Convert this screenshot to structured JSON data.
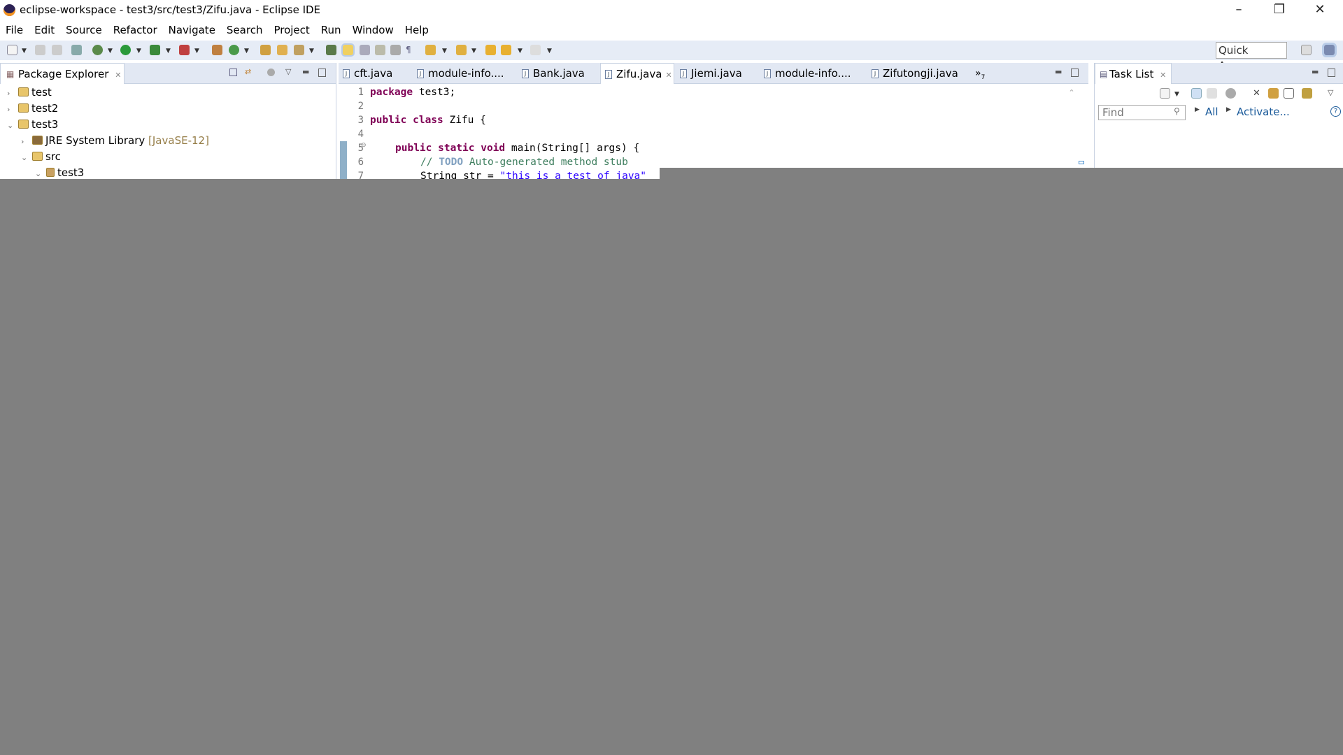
{
  "window": {
    "title": "eclipse-workspace - test3/src/test3/Zifu.java - Eclipse IDE"
  },
  "menu": [
    "File",
    "Edit",
    "Source",
    "Refactor",
    "Navigate",
    "Search",
    "Project",
    "Run",
    "Window",
    "Help"
  ],
  "toolbar": {
    "quick_access": "Quick Access"
  },
  "package_explorer": {
    "title": "Package Explorer",
    "tree": [
      {
        "label": "test",
        "expanded": false,
        "level": 0
      },
      {
        "label": "test2",
        "expanded": false,
        "level": 0
      },
      {
        "label": "test3",
        "expanded": true,
        "level": 0
      },
      {
        "label": "JRE System Library",
        "decoration": "[JavaSE-12]",
        "expanded": false,
        "level": 1
      },
      {
        "label": "src",
        "expanded": true,
        "level": 1
      },
      {
        "label": "test3",
        "expanded": true,
        "level": 2
      }
    ]
  },
  "editor": {
    "tabs": [
      "cft.java",
      "module-info....",
      "Bank.java",
      "Zifu.java",
      "Jiemi.java",
      "module-info....",
      "Zifutongji.java"
    ],
    "active_tab": "Zifu.java",
    "overflow": "»",
    "overflow_count": "7",
    "lines": [
      {
        "n": "1",
        "kw": "package",
        "rest": " test3;"
      },
      {
        "n": "2"
      },
      {
        "n": "3",
        "kw": "public class",
        "rest": " Zifu {"
      },
      {
        "n": "4"
      },
      {
        "n": "5",
        "indent": "    ",
        "kw": "public static void",
        "rest": " main(String[] args) {"
      },
      {
        "n": "6",
        "comment": "// ",
        "todo": "TODO",
        "comment2": " Auto-generated method stub"
      },
      {
        "n": "7",
        "code": "String str = ",
        "str": "\"this is a test of java\""
      }
    ]
  },
  "task_list": {
    "title": "Task List",
    "find_placeholder": "Find",
    "all": "All",
    "activate": "Activate...",
    "help": "?"
  }
}
